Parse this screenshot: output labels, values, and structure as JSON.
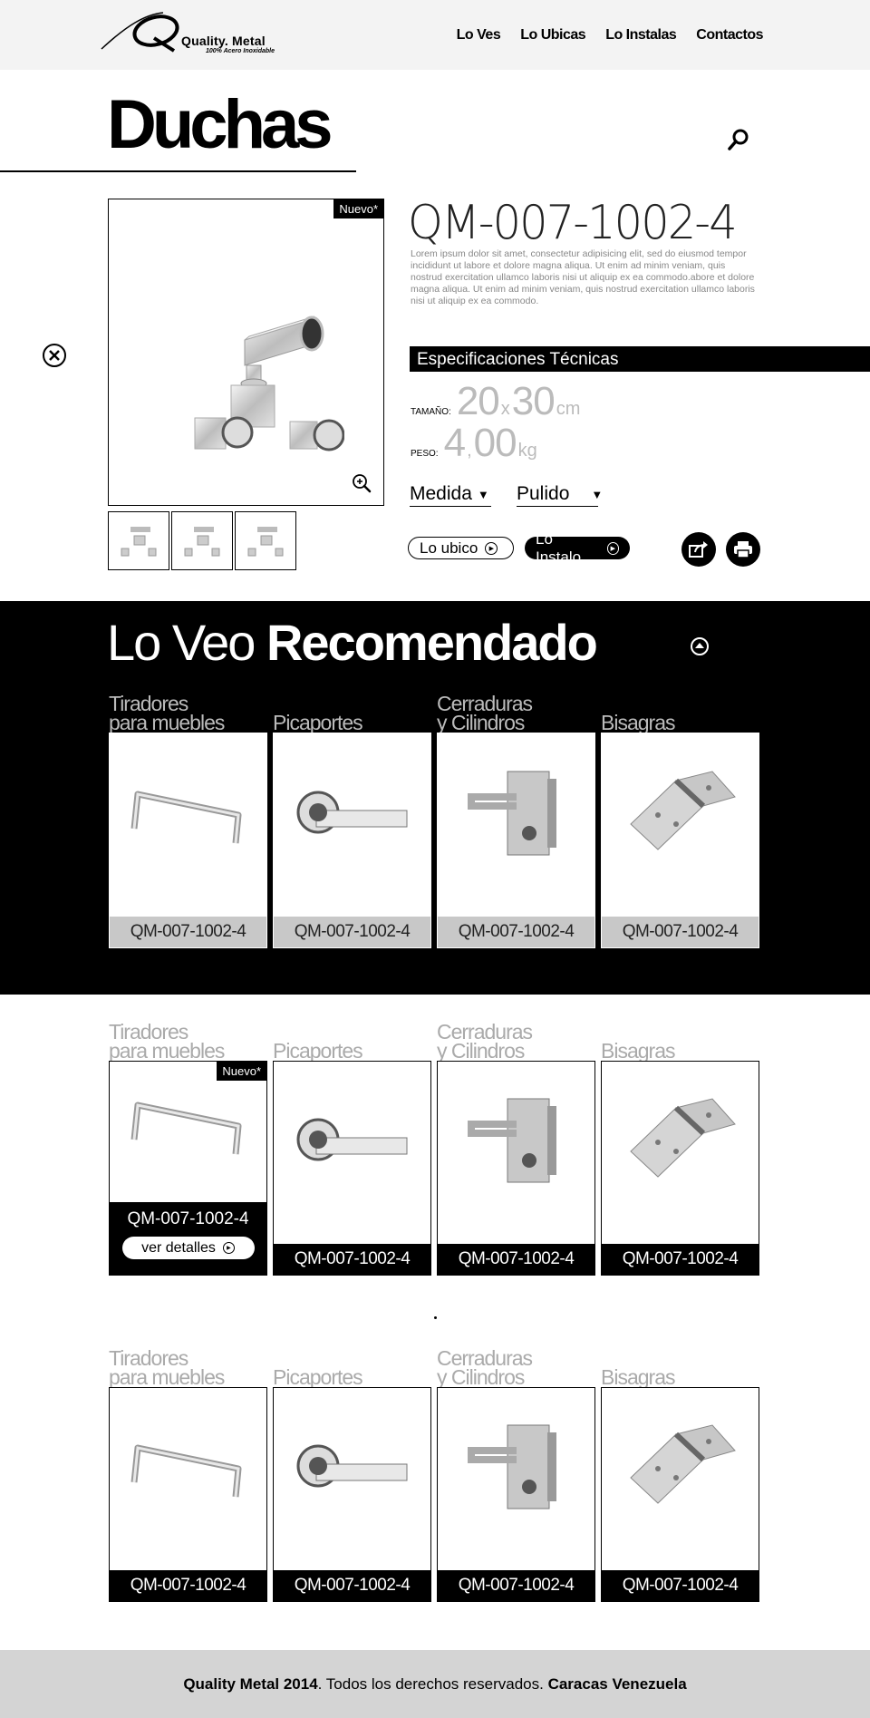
{
  "brand": {
    "name": "Quality. Metal",
    "tagline": "100% Acero Inoxidable"
  },
  "nav": [
    {
      "label": "Lo Ves"
    },
    {
      "label": "Lo Ubicas"
    },
    {
      "label": "Lo Instalas"
    },
    {
      "label": "Contactos"
    }
  ],
  "page": {
    "title": "Duchas"
  },
  "product": {
    "badge": "Nuevo*",
    "code": "QM-007-1002-4",
    "description": "Lorem ipsum dolor sit amet, consectetur adipisicing elit, sed do eiusmod tempor incididunt ut labore et dolore magna aliqua. Ut enim ad minim veniam, quis nostrud exercitation ullamco laboris nisi ut aliquip ex ea commodo.abore et dolore magna aliqua. Ut enim ad minim veniam, quis nostrud exercitation ullamco laboris nisi ut aliquip ex ea commodo.",
    "specs_title": "Especificaciones Técnicas",
    "size_label": "TAMAÑO:",
    "size_a": "20",
    "size_x": "x",
    "size_b": "30",
    "size_unit": "cm",
    "weight_label": "PESO:",
    "weight_int": "4",
    "weight_sep": ",",
    "weight_dec": "00",
    "weight_unit": "kg",
    "select_size": "Medida",
    "select_finish": "Pulido",
    "btn_locate": "Lo ubico",
    "btn_install": "Lo Instalo"
  },
  "recommended": {
    "title_light": "Lo Veo",
    "title_bold": "Recomendado"
  },
  "categories": {
    "c1": "Tiradores\npara muebles",
    "c2": "Picaportes",
    "c3": "Cerraduras\ny Cilindros",
    "c4": "Bisagras"
  },
  "card_code": "QM-007-1002-4",
  "card_badge": "Nuevo*",
  "details_label": "ver detalles",
  "footer": {
    "brand": "Quality Metal 2014",
    "text": ". Todos los derechos reservados. ",
    "location": "Caracas Venezuela"
  }
}
